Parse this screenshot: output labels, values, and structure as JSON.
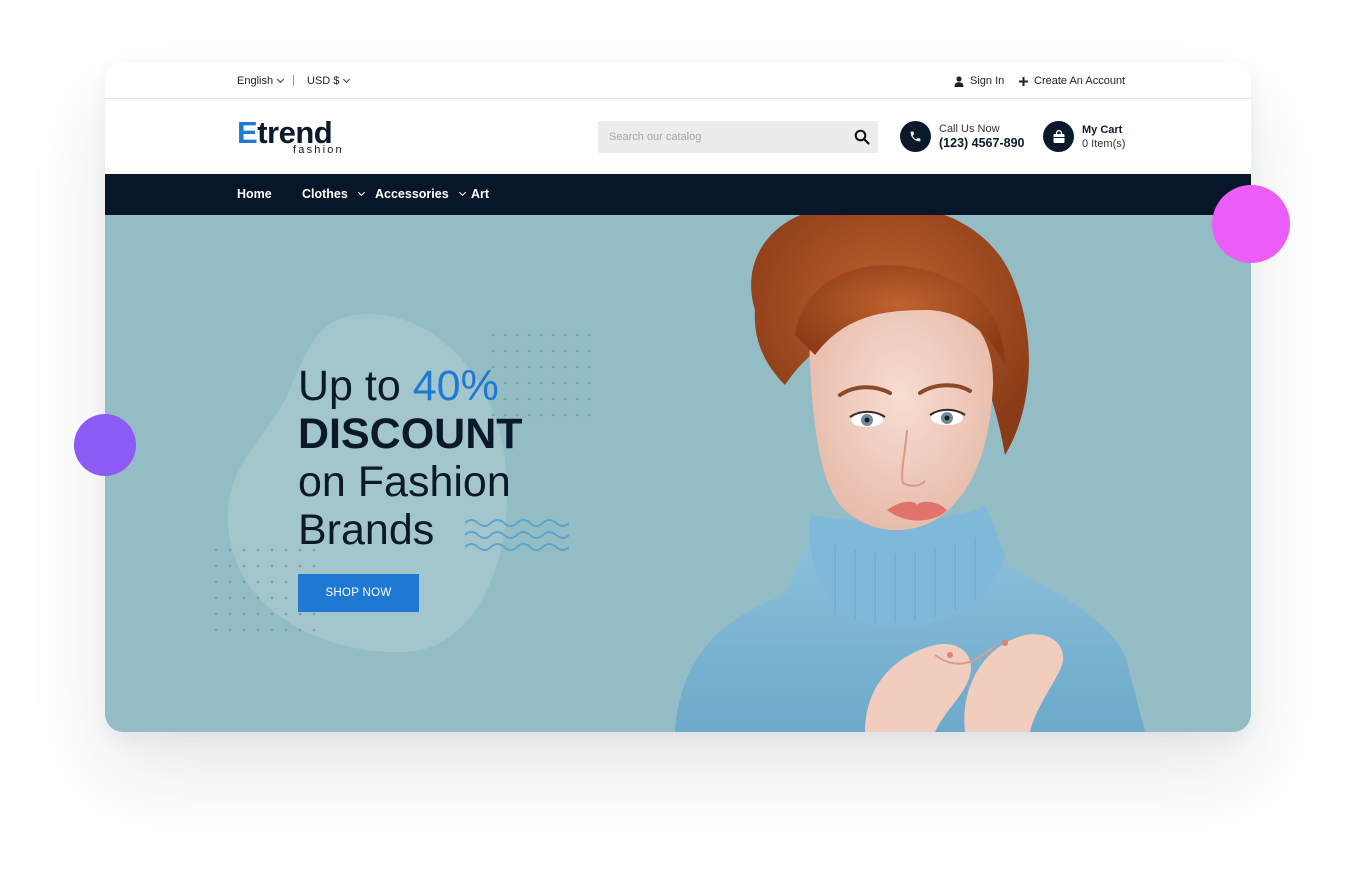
{
  "topbar": {
    "language": "English",
    "separator": "|",
    "currency": "USD $",
    "sign_in": "Sign In",
    "create_account": "Create An Account"
  },
  "header": {
    "logo_main": "Etrend",
    "logo_sub": "fashion",
    "search_placeholder": "Search our catalog",
    "call_label": "Call Us Now",
    "call_number": "(123) 4567-890",
    "cart_label": "My Cart",
    "cart_items": "0 Item(s)"
  },
  "nav": {
    "items": [
      {
        "label": "Home"
      },
      {
        "label": "Clothes"
      },
      {
        "label": "Accessories"
      },
      {
        "label": "Art"
      }
    ]
  },
  "hero": {
    "line1_prefix": "Up to",
    "line1_accent": "40%",
    "line2": "DISCOUNT",
    "line3": "on Fashion",
    "line4": "Brands",
    "cta": "SHOP NOW"
  },
  "colors": {
    "accent": "#1f78d1",
    "navy": "#071628",
    "hero_bg": "#93bcc4",
    "deco_purple": "#8d5af5",
    "deco_pink": "#ec5cf7"
  }
}
